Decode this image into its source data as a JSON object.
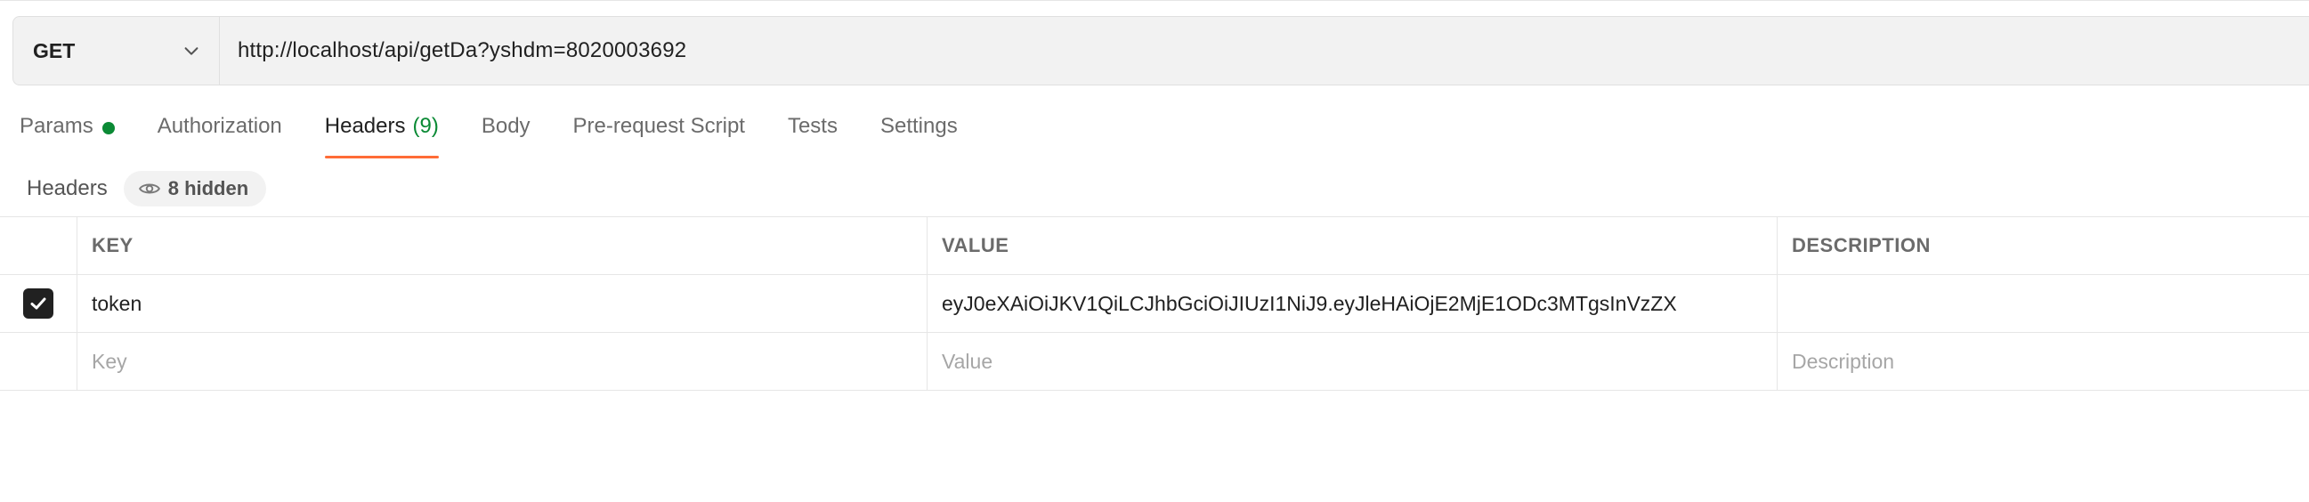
{
  "request": {
    "method": "GET",
    "url": "http://localhost/api/getDa?yshdm=8020003692"
  },
  "tabs": [
    {
      "label": "Params",
      "has_dot": true
    },
    {
      "label": "Authorization"
    },
    {
      "label": "Headers",
      "count": "(9)",
      "active": true
    },
    {
      "label": "Body"
    },
    {
      "label": "Pre-request Script"
    },
    {
      "label": "Tests"
    },
    {
      "label": "Settings"
    }
  ],
  "headers_section": {
    "title": "Headers",
    "hidden_label": "8 hidden"
  },
  "table": {
    "columns": [
      "KEY",
      "VALUE",
      "DESCRIPTION"
    ],
    "rows": [
      {
        "checked": true,
        "key": "token",
        "value": "eyJ0eXAiOiJKV1QiLCJhbGciOiJIUzI1NiJ9.eyJleHAiOjE2MjE1ODc3MTgsInVzZX",
        "description": ""
      }
    ],
    "placeholders": {
      "key": "Key",
      "value": "Value",
      "description": "Description"
    }
  },
  "colors": {
    "accent_orange": "#ff6c37",
    "status_green": "#0b8a35"
  }
}
